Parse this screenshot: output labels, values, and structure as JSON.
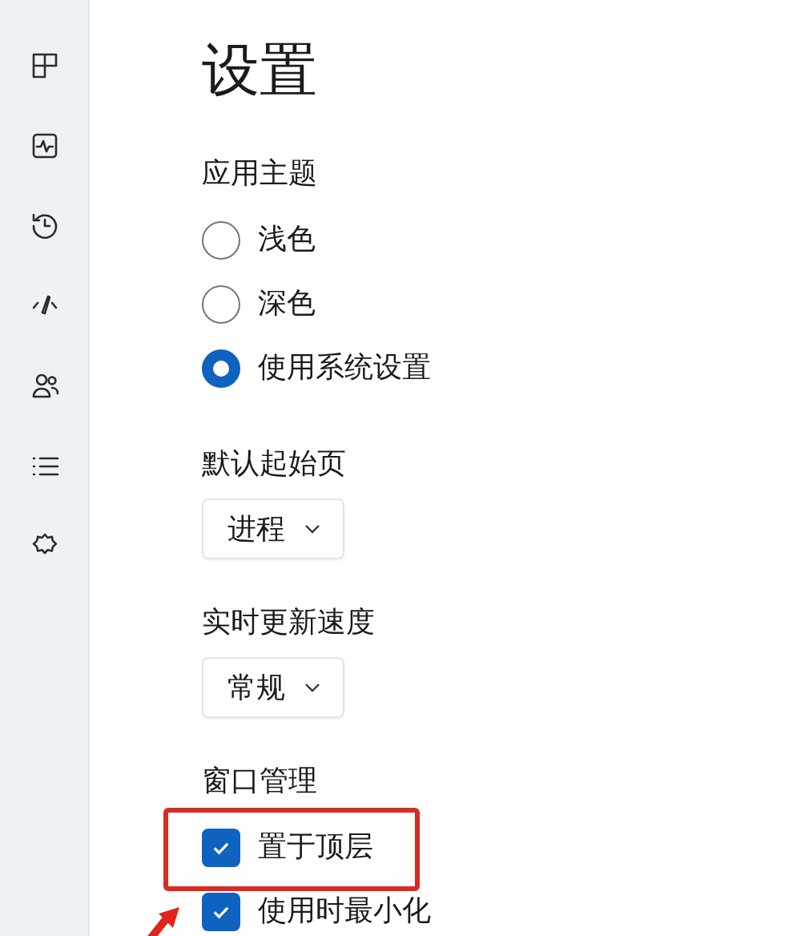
{
  "title": "设置",
  "sections": [
    {
      "kind": "radio",
      "label": "应用主题",
      "options": [
        {
          "label": "浅色",
          "selected": false
        },
        {
          "label": "深色",
          "selected": false
        },
        {
          "label": "使用系统设置",
          "selected": true
        }
      ]
    },
    {
      "kind": "dropdown",
      "label": "默认起始页",
      "value": "进程"
    },
    {
      "kind": "dropdown",
      "label": "实时更新速度",
      "value": "常规"
    },
    {
      "kind": "checkbox",
      "label": "窗口管理",
      "options": [
        {
          "label": "置于顶层",
          "checked": true
        },
        {
          "label": "使用时最小化",
          "checked": true
        }
      ]
    }
  ]
}
